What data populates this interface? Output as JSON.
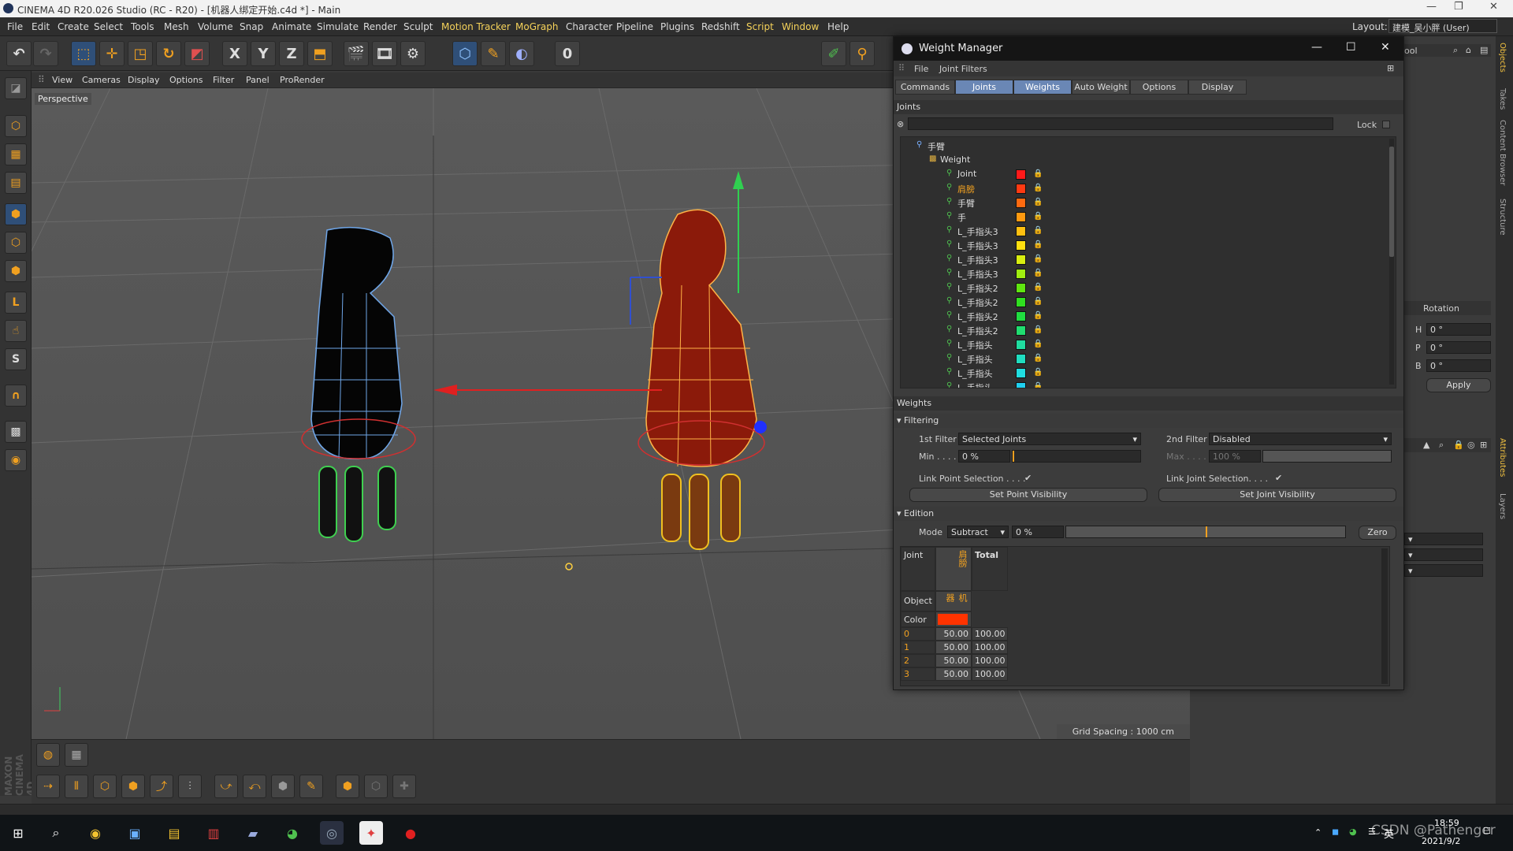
{
  "window": {
    "title": "CINEMA 4D R20.026 Studio (RC - R20) - [机器人绑定开始.c4d *] - Main"
  },
  "menubar": {
    "items": [
      "File",
      "Edit",
      "Create",
      "Select",
      "Tools",
      "Mesh",
      "Volume",
      "Snap",
      "Animate",
      "Simulate",
      "Render",
      "Sculpt",
      "Motion Tracker",
      "MoGraph",
      "Character",
      "Pipeline",
      "Plugins",
      "Redshift",
      "Script",
      "Window",
      "Help"
    ],
    "layout_label": "Layout:",
    "layout_value": "建模_吴小胖 (User)"
  },
  "toolbar": {
    "axis_x": "X",
    "axis_y": "Y",
    "axis_z": "Z",
    "keyframe_label": "0"
  },
  "viewport_menu": [
    "View",
    "Cameras",
    "Display",
    "Options",
    "Filter",
    "Panel",
    "ProRender"
  ],
  "viewport": {
    "label": "Perspective",
    "grid_spacing": "Grid Spacing : 1000 cm"
  },
  "weight_manager": {
    "title": "Weight Manager",
    "menu": [
      "File",
      "Joint Filters"
    ],
    "tabs": [
      "Commands",
      "Joints",
      "Weights",
      "Auto Weight",
      "Options",
      "Display"
    ],
    "joints_header": "Joints",
    "lock_label": "Lock",
    "tree_root": "手臂",
    "tree_weight": "Weight",
    "joints": [
      {
        "name": "Joint",
        "color": "#ff1a1a",
        "highlight": false
      },
      {
        "name": "肩膀",
        "color": "#ff3a12",
        "highlight": true
      },
      {
        "name": "手臂",
        "color": "#ff6a10",
        "highlight": false
      },
      {
        "name": "手",
        "color": "#ff9a10",
        "highlight": false
      },
      {
        "name": "L_手指头3",
        "color": "#ffc010",
        "highlight": false
      },
      {
        "name": "L_手指头3",
        "color": "#ffe010",
        "highlight": false
      },
      {
        "name": "L_手指头3",
        "color": "#d8ee10",
        "highlight": false
      },
      {
        "name": "L_手指头3",
        "color": "#a0ee10",
        "highlight": false
      },
      {
        "name": "L_手指头2",
        "color": "#60e610",
        "highlight": false
      },
      {
        "name": "L_手指头2",
        "color": "#30e020",
        "highlight": false
      },
      {
        "name": "L_手指头2",
        "color": "#20dd40",
        "highlight": false
      },
      {
        "name": "L_手指头2",
        "color": "#20dd70",
        "highlight": false
      },
      {
        "name": "L_手指头",
        "color": "#20dda0",
        "highlight": false
      },
      {
        "name": "L_手指头",
        "color": "#20ddc0",
        "highlight": false
      },
      {
        "name": "L_手指头",
        "color": "#20dde0",
        "highlight": false
      },
      {
        "name": "L_手指头",
        "color": "#20d0f0",
        "highlight": false
      }
    ],
    "weights_header": "Weights",
    "filtering": {
      "header": "Filtering",
      "first_filter_label": "1st Filter",
      "first_filter_value": "Selected Joints",
      "second_filter_label": "2nd Filter",
      "second_filter_value": "Disabled",
      "min_label": "Min . . . .",
      "min_value": "0 %",
      "max_label": "Max . . . .",
      "max_value": "100 %",
      "link_point_label": "Link Point Selection . . . .",
      "link_joint_label": "Link Joint Selection. . . .",
      "set_point_visibility": "Set Point Visibility",
      "set_joint_visibility": "Set Joint Visibility"
    },
    "edition": {
      "header": "Edition",
      "mode_label": "Mode",
      "mode_value": "Subtract",
      "amount": "0 %",
      "amount_fraction": 0.5,
      "zero_button": "Zero"
    },
    "table": {
      "joint_label": "Joint",
      "total_label": "Total",
      "object_label": "Object",
      "color_label": "Color",
      "joint_name": "肩膀",
      "object_name": "机器",
      "joint_color": "#ff3300",
      "rows": [
        {
          "index": "0",
          "value": "50.00",
          "total": "100.00"
        },
        {
          "index": "1",
          "value": "50.00",
          "total": "100.00"
        },
        {
          "index": "2",
          "value": "50.00",
          "total": "100.00"
        },
        {
          "index": "3",
          "value": "50.00",
          "total": "100.00"
        }
      ]
    }
  },
  "attributes": {
    "rotation_header": "Rotation",
    "rows": [
      {
        "axis": "H",
        "value": "0 °"
      },
      {
        "axis": "P",
        "value": "0 °"
      },
      {
        "axis": "B",
        "value": "0 °"
      }
    ],
    "apply": "Apply",
    "tool_label": "ool"
  },
  "right_tabs": [
    "Objects",
    "Takes",
    "Content Browser",
    "Structure"
  ],
  "right_tabs_lower": [
    "Attributes",
    "Layers"
  ],
  "maxon_logo": "MAXON CINEMA 4D",
  "taskbar": {
    "time": "18:59",
    "date": "2021/9/2",
    "ime": "英",
    "watermark": "CSDN @Pathenger"
  }
}
